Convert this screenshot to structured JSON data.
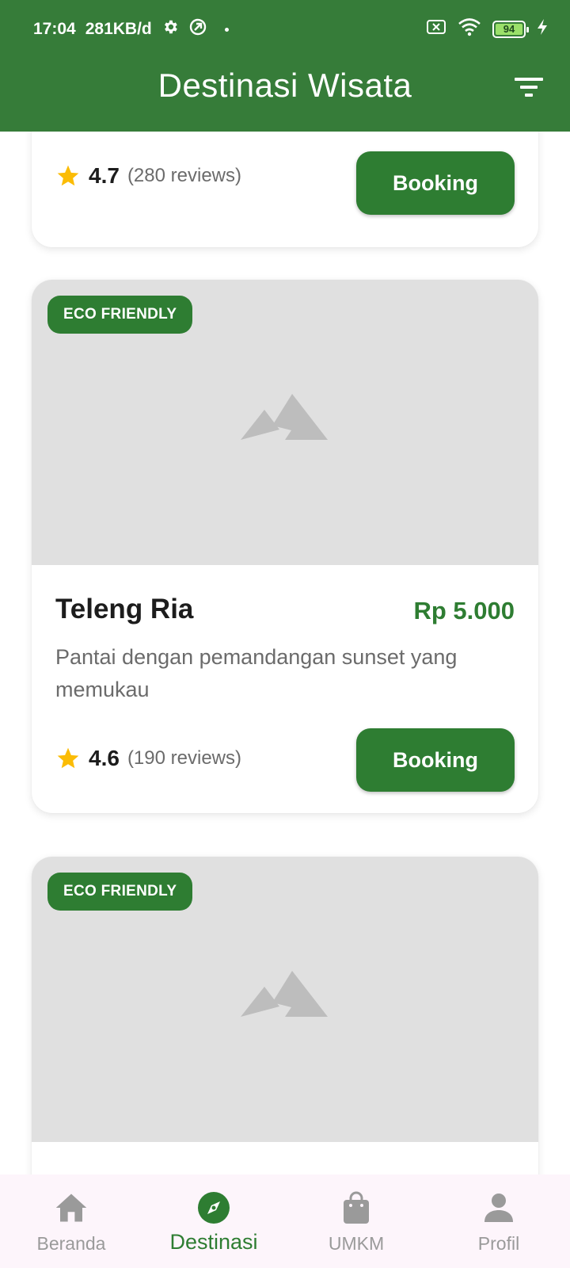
{
  "status_bar": {
    "time": "17:04",
    "speed": "281KB/d",
    "battery": "94"
  },
  "app_bar": {
    "title": "Destinasi Wisata",
    "filter_icon": "filter-icon"
  },
  "colors": {
    "primary": "#2e7d32",
    "app_bar": "#367c39",
    "star": "#fbbc05",
    "placeholder": "#e0e0e0"
  },
  "cards": [
    {
      "rating": "4.7",
      "reviews": "(280 reviews)",
      "button": "Booking"
    },
    {
      "badge": "ECO FRIENDLY",
      "name": "Teleng Ria",
      "price": "Rp 5.000",
      "description": "Pantai dengan pemandangan sunset yang memukau",
      "rating": "4.6",
      "reviews": "(190 reviews)",
      "button": "Booking"
    },
    {
      "badge": "ECO FRIENDLY"
    }
  ],
  "bottom_nav": {
    "items": [
      {
        "label": "Beranda",
        "icon": "home-icon"
      },
      {
        "label": "Destinasi",
        "icon": "compass-icon",
        "active": true
      },
      {
        "label": "UMKM",
        "icon": "shopping-bag-icon"
      },
      {
        "label": "Profil",
        "icon": "person-icon"
      }
    ]
  }
}
